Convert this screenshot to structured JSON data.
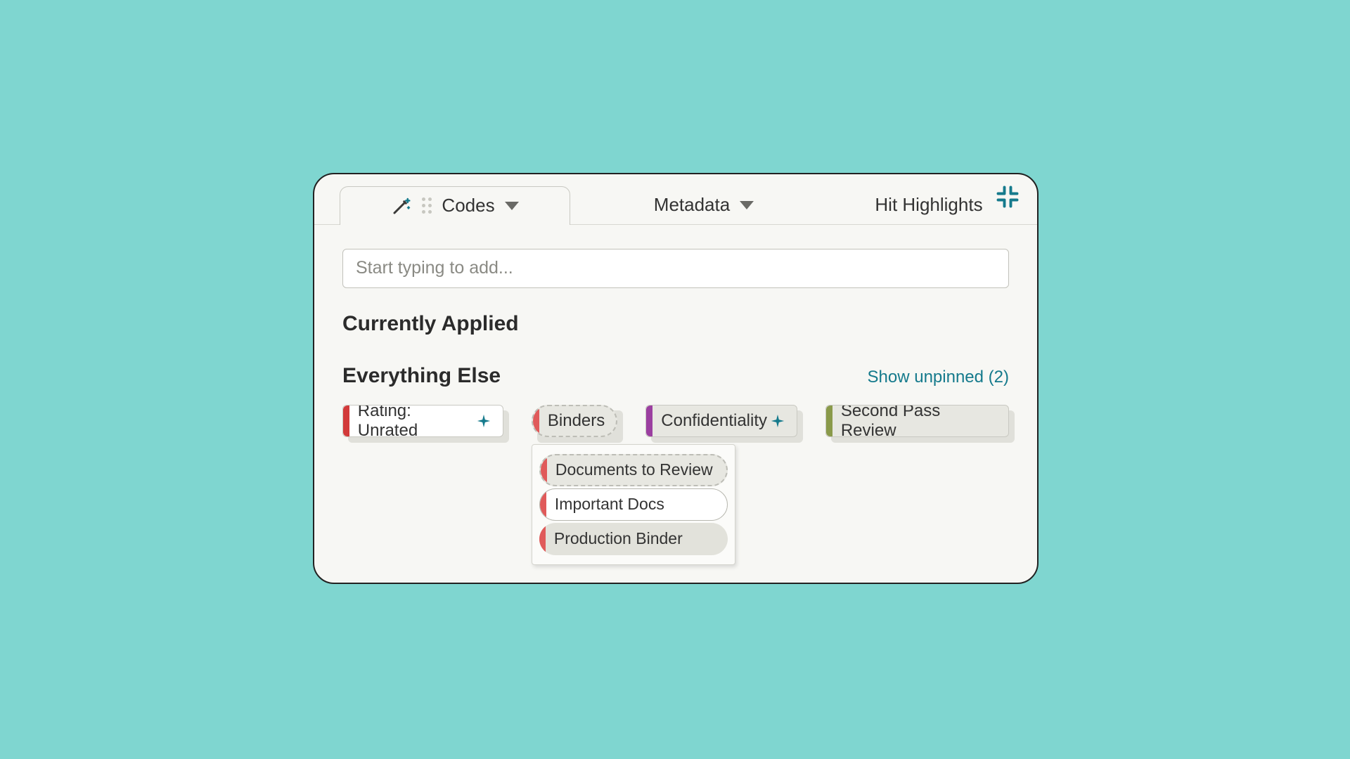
{
  "tabs": {
    "codes": "Codes",
    "metadata": "Metadata",
    "hits": "Hit Highlights"
  },
  "search": {
    "placeholder": "Start typing to add..."
  },
  "sections": {
    "applied": "Currently Applied",
    "else": "Everything Else"
  },
  "show_unpinned": "Show unpinned (2)",
  "pills": {
    "rating": {
      "label": "Rating: Unrated",
      "color": "#d23a3a"
    },
    "binders": {
      "label": "Binders",
      "color": "#e05a5a"
    },
    "confidentiality": {
      "label": "Confidentiality",
      "color": "#9b3fa0"
    },
    "second_pass": {
      "label": "Second Pass Review",
      "color": "#8a9a4a"
    }
  },
  "binders_dropdown": [
    {
      "label": "Documents to Review",
      "style": "dashed",
      "color": "#e05a5a"
    },
    {
      "label": "Important Docs",
      "style": "solid",
      "color": "#e05a5a"
    },
    {
      "label": "Production Binder",
      "style": "gray",
      "color": "#e05a5a"
    }
  ],
  "colors": {
    "accent": "#157a8c"
  }
}
